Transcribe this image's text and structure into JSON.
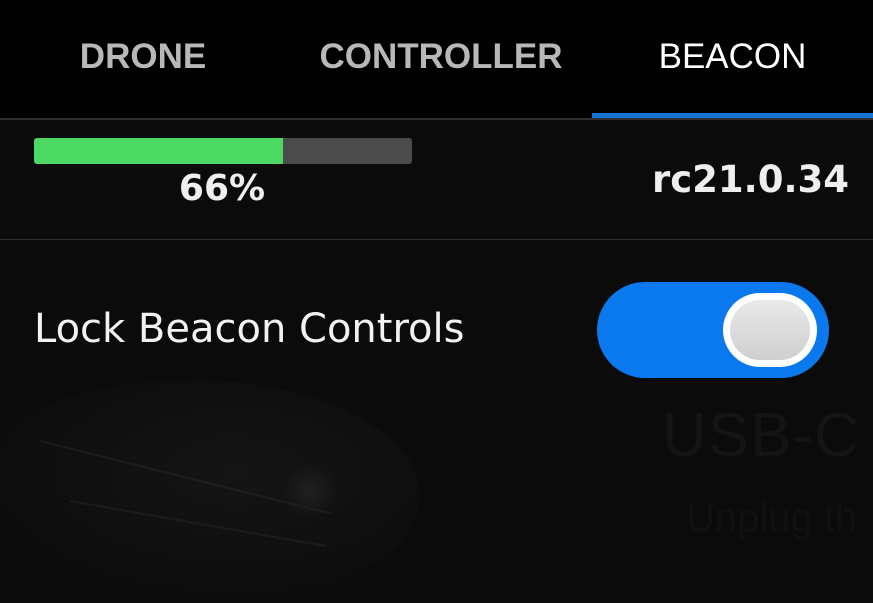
{
  "tabs": [
    {
      "label": "DRONE",
      "active": false
    },
    {
      "label": "CONTROLLER",
      "active": false
    },
    {
      "label": "BEACON",
      "active": true
    }
  ],
  "firmware": {
    "progress_percent": 66,
    "progress_label": "66%",
    "version": "rc21.0.34"
  },
  "settings": {
    "lock_beacon_controls": {
      "label": "Lock Beacon Controls",
      "enabled": true
    }
  },
  "background": {
    "title": "USB-C",
    "subtitle": "Unplug th"
  },
  "colors": {
    "accent": "#0a79ee",
    "tab_indicator": "#1a74d8",
    "progress_fill": "#4bd964",
    "progress_track": "#4b4b4b",
    "background": "#0b0b0b"
  }
}
